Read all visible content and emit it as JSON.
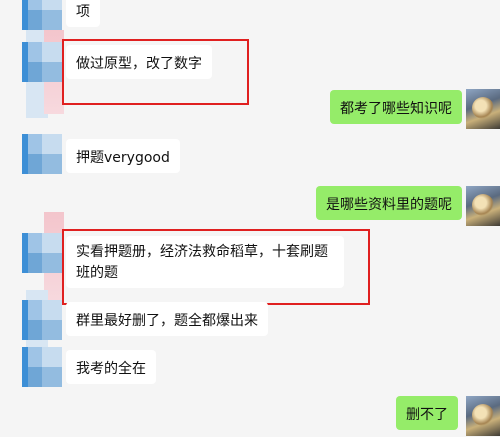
{
  "messages": [
    {
      "side": "left",
      "text": "项"
    },
    {
      "side": "left",
      "text": "做过原型，改了数字"
    },
    {
      "side": "right",
      "text": "都考了哪些知识呢"
    },
    {
      "side": "left",
      "text": "押题verygood"
    },
    {
      "side": "right",
      "text": "是哪些资料里的题呢"
    },
    {
      "side": "left",
      "text": "实看押题册，经济法救命稻草，十套刷题班的题"
    },
    {
      "side": "left",
      "text": "群里最好删了，题全都爆出来"
    },
    {
      "side": "left",
      "text": "我考的全在"
    },
    {
      "side": "right",
      "text": "删不了"
    }
  ],
  "colors": {
    "background": "#f5f5f5",
    "incoming_bubble": "#ffffff",
    "outgoing_bubble": "#95ec69",
    "highlight_box": "#e02020"
  }
}
